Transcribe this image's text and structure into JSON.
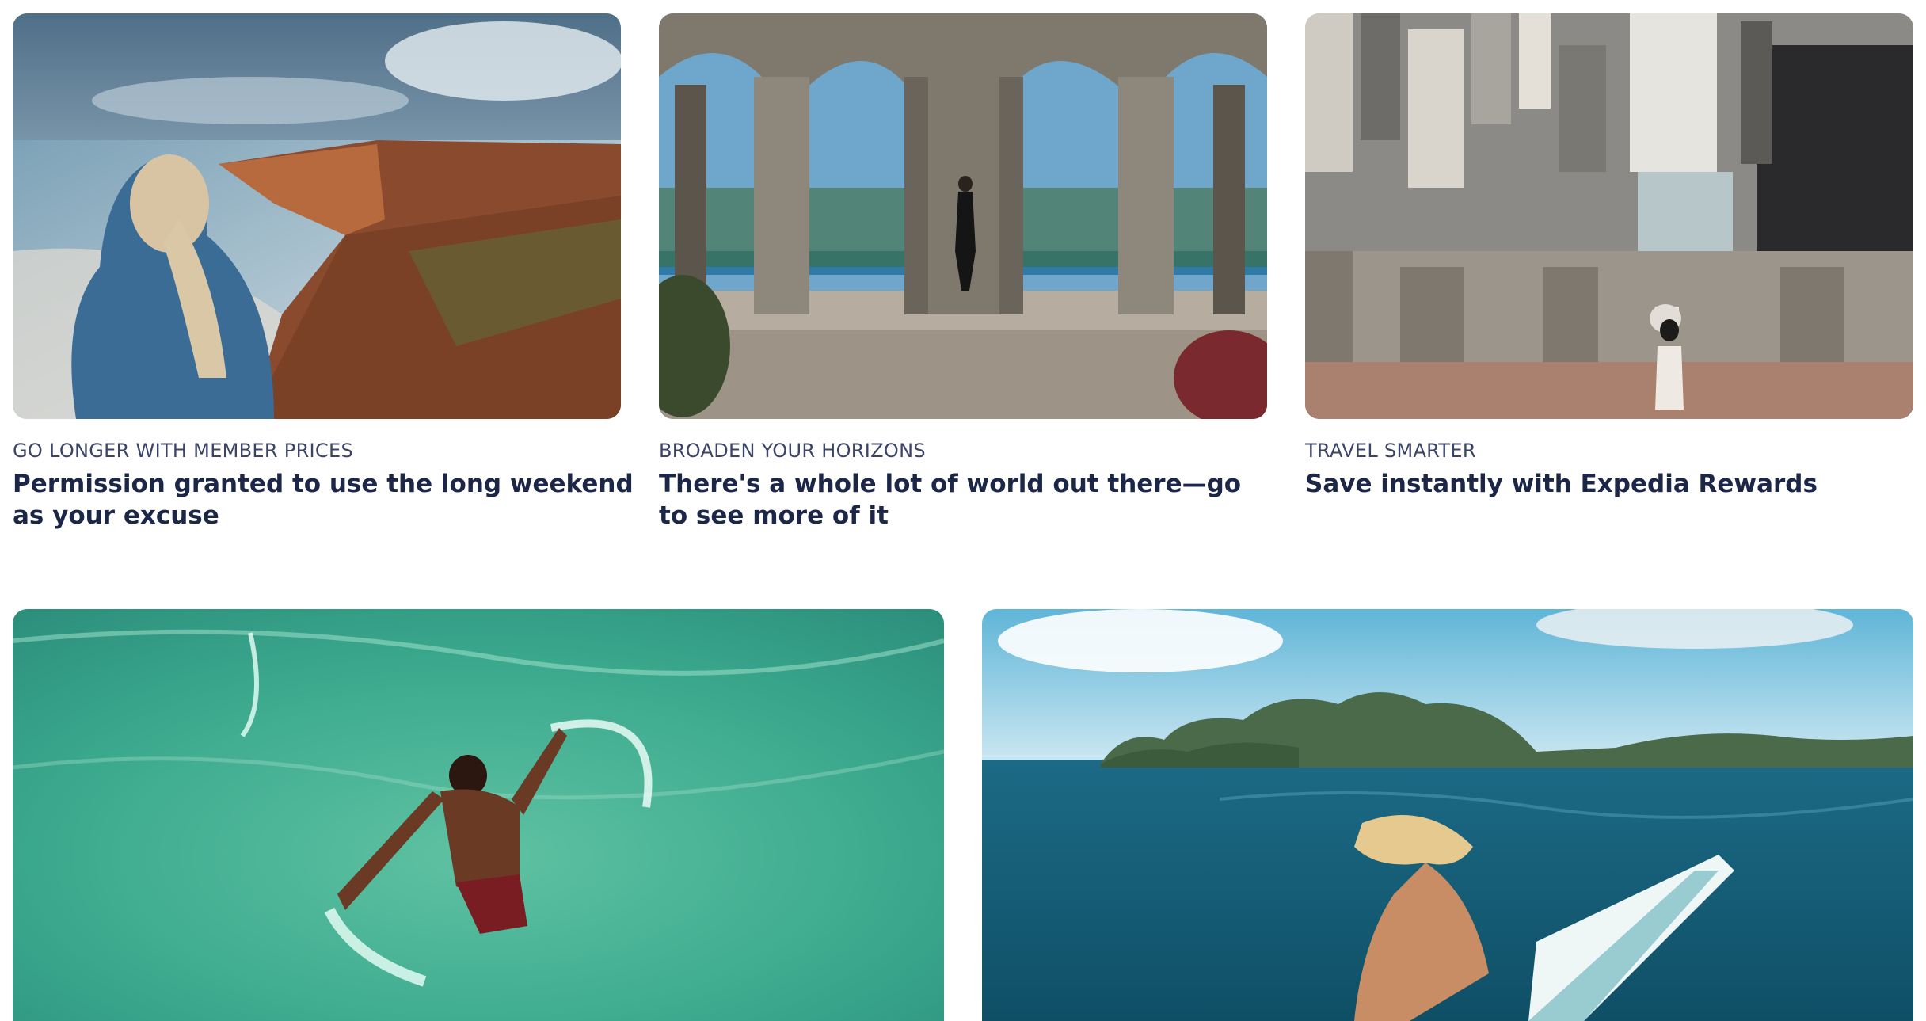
{
  "cards": [
    {
      "eyebrow": "GO LONGER WITH MEMBER PRICES",
      "title": "Permission granted to use the long weekend as your excuse",
      "image": "coastal-cliffs-woman-photo"
    },
    {
      "eyebrow": "BROADEN YOUR HORIZONS",
      "title": "There's a whole lot of world out there—go to see more of it",
      "image": "stone-arches-woman-photo"
    },
    {
      "eyebrow": "TRAVEL SMARTER",
      "title": "Save instantly with Expedia Rewards",
      "image": "city-rooftop-viewer-photo"
    }
  ],
  "banners": [
    {
      "image": "man-swimming-turquoise-sea-photo"
    },
    {
      "image": "woman-on-boat-islands-photo"
    }
  ],
  "colors": {
    "text_primary": "#1c2748",
    "text_secondary": "#3b4466"
  }
}
